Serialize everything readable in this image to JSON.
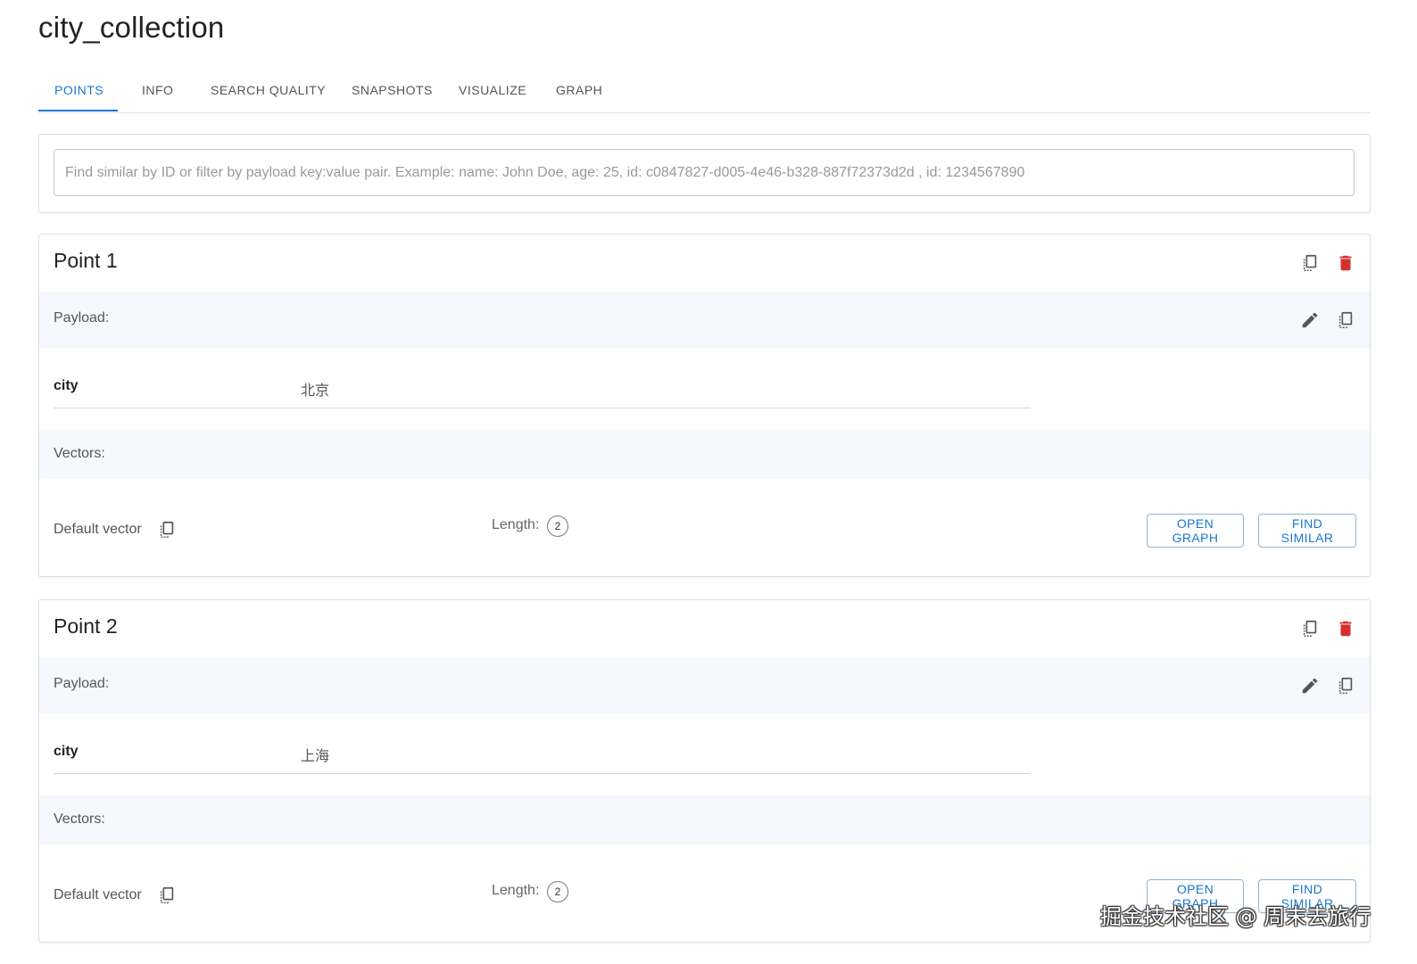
{
  "collection_title": "city_collection",
  "tabs": [
    {
      "label": "POINTS",
      "active": true
    },
    {
      "label": "INFO",
      "active": false
    },
    {
      "label": "SEARCH QUALITY",
      "active": false
    },
    {
      "label": "SNAPSHOTS",
      "active": false
    },
    {
      "label": "VISUALIZE",
      "active": false
    },
    {
      "label": "GRAPH",
      "active": false
    }
  ],
  "search": {
    "placeholder": "Find similar by ID or filter by payload key:value pair. Example: name: John Doe, age: 25, id: c0847827-d005-4e46-b328-887f72373d2d , id: 1234567890",
    "value": ""
  },
  "points": [
    {
      "title": "Point 1",
      "payload_label": "Payload:",
      "payload": [
        {
          "key": "city",
          "value": "北京"
        }
      ],
      "vectors_label": "Vectors:",
      "vector_name": "Default vector",
      "length_label": "Length:",
      "length": "2",
      "open_graph_label": "OPEN GRAPH",
      "find_similar_label": "FIND SIMILAR"
    },
    {
      "title": "Point 2",
      "payload_label": "Payload:",
      "payload": [
        {
          "key": "city",
          "value": "上海"
        }
      ],
      "vectors_label": "Vectors:",
      "vector_name": "Default vector",
      "length_label": "Length:",
      "length": "2",
      "open_graph_label": "OPEN GRAPH",
      "find_similar_label": "FIND SIMILAR"
    }
  ],
  "icons": {
    "copy": "copy-icon",
    "delete": "delete-icon",
    "edit": "edit-icon"
  },
  "colors": {
    "accent": "#1976d2",
    "delete": "#d32f2f",
    "band": "#f5f8fc"
  },
  "watermark": "掘金技术社区 @ 周末去旅行"
}
